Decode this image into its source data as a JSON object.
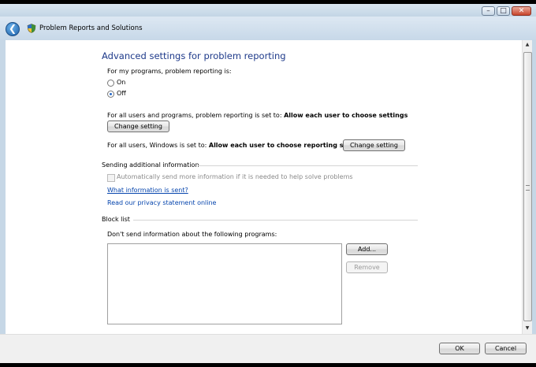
{
  "window": {
    "minimize_glyph": "–",
    "maximize_glyph": "□",
    "close_glyph": "✕"
  },
  "nav": {
    "back_glyph": "❮",
    "title": "Problem Reports and Solutions",
    "icon": "problem-reports-shield-icon"
  },
  "page": {
    "heading": "Advanced settings for problem reporting",
    "my_programs_label": "For my programs, problem reporting is:",
    "radio_on": "On",
    "radio_off": "Off",
    "selected_radio": "off",
    "all_users_programs_text": "For all users and programs, problem reporting is set to: ",
    "all_users_programs_value": "Allow each user to choose settings",
    "change_setting_1": "Change setting",
    "windows_text": "For all users, Windows is set to: ",
    "windows_value": "Allow each user to choose reporting settings",
    "change_setting_2": "Change setting",
    "sending_section": "Sending additional information",
    "auto_send_label": "Automatically send more information if it is needed to help solve problems",
    "auto_send_checked": false,
    "what_info_link": "What information is sent?",
    "privacy_link": "Read our privacy statement online",
    "block_section": "Block list",
    "block_label": "Don't send information about the following programs:",
    "blocked_programs": [],
    "add_button": "Add...",
    "remove_button": "Remove"
  },
  "footer": {
    "ok_button": "OK",
    "cancel_button": "Cancel"
  },
  "colors": {
    "heading": "#1e3a8a",
    "link": "#0645ad",
    "chrome": "#c6d7e6"
  }
}
